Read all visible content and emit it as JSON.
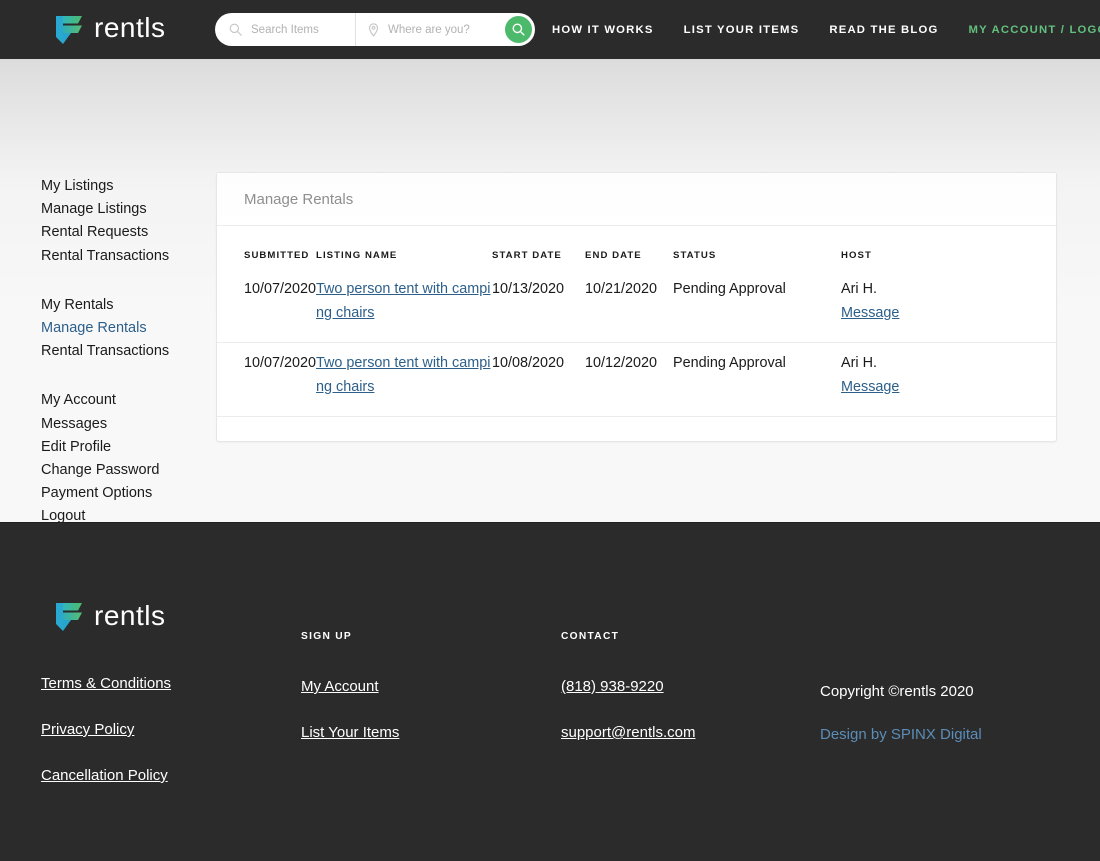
{
  "brand": {
    "name": "rentls",
    "logo_icon": "rentls-logo-mark",
    "accent_green": "#62c07e",
    "link_blue": "#2c5f8a",
    "header_bg": "#2b2b2b"
  },
  "header": {
    "search": {
      "items_placeholder": "Search Items",
      "items_value": "",
      "location_placeholder": "Where are you?",
      "location_value": "",
      "search_icon": "magnifier-icon",
      "location_icon": "map-pin-icon",
      "submit_icon": "magnifier-icon"
    },
    "nav": [
      {
        "label": "HOW IT WORKS",
        "accent": false
      },
      {
        "label": "LIST YOUR ITEMS",
        "accent": false
      },
      {
        "label": "READ THE BLOG",
        "accent": false
      },
      {
        "label": "MY ACCOUNT / LOGOUT",
        "accent": true
      }
    ]
  },
  "sidebar": {
    "groups": [
      {
        "items": [
          {
            "label": "My Listings",
            "active": false
          },
          {
            "label": "Manage Listings",
            "active": false
          },
          {
            "label": "Rental Requests",
            "active": false
          },
          {
            "label": "Rental Transactions",
            "active": false
          }
        ]
      },
      {
        "items": [
          {
            "label": "My Rentals",
            "active": false
          },
          {
            "label": "Manage Rentals",
            "active": true
          },
          {
            "label": "Rental Transactions",
            "active": false
          }
        ]
      },
      {
        "items": [
          {
            "label": "My Account",
            "active": false
          },
          {
            "label": "Messages",
            "active": false
          },
          {
            "label": "Edit Profile",
            "active": false
          },
          {
            "label": "Change Password",
            "active": false
          },
          {
            "label": "Payment Options",
            "active": false
          },
          {
            "label": "Logout",
            "active": false
          }
        ]
      }
    ]
  },
  "main": {
    "card_title": "Manage Rentals",
    "table": {
      "columns": [
        "SUBMITTED",
        "LISTING NAME",
        "START DATE",
        "END DATE",
        "STATUS",
        "HOST"
      ],
      "rows": [
        {
          "submitted": "10/07/2020",
          "listing_name": "Two person tent with camping chairs",
          "start_date": "10/13/2020",
          "end_date": "10/21/2020",
          "status": "Pending Approval",
          "host_name": "Ari H.",
          "host_action": "Message"
        },
        {
          "submitted": "10/07/2020",
          "listing_name": "Two person tent with camping chairs",
          "start_date": "10/08/2020",
          "end_date": "10/12/2020",
          "status": "Pending Approval",
          "host_name": "Ari H.",
          "host_action": "Message"
        }
      ]
    }
  },
  "footer": {
    "legal_links": [
      {
        "label": "Terms & Conditions"
      },
      {
        "label": "Privacy Policy"
      },
      {
        "label": "Cancellation Policy"
      }
    ],
    "signup": {
      "heading": "SIGN UP",
      "links": [
        {
          "label": "My Account"
        },
        {
          "label": "List Your Items"
        }
      ]
    },
    "contact": {
      "heading": "CONTACT",
      "links": [
        {
          "label": "(818) 938-9220"
        },
        {
          "label": "support@rentls.com"
        }
      ]
    },
    "copyright": "Copyright ©rentls 2020",
    "design_credit": "Design by SPINX Digital"
  }
}
